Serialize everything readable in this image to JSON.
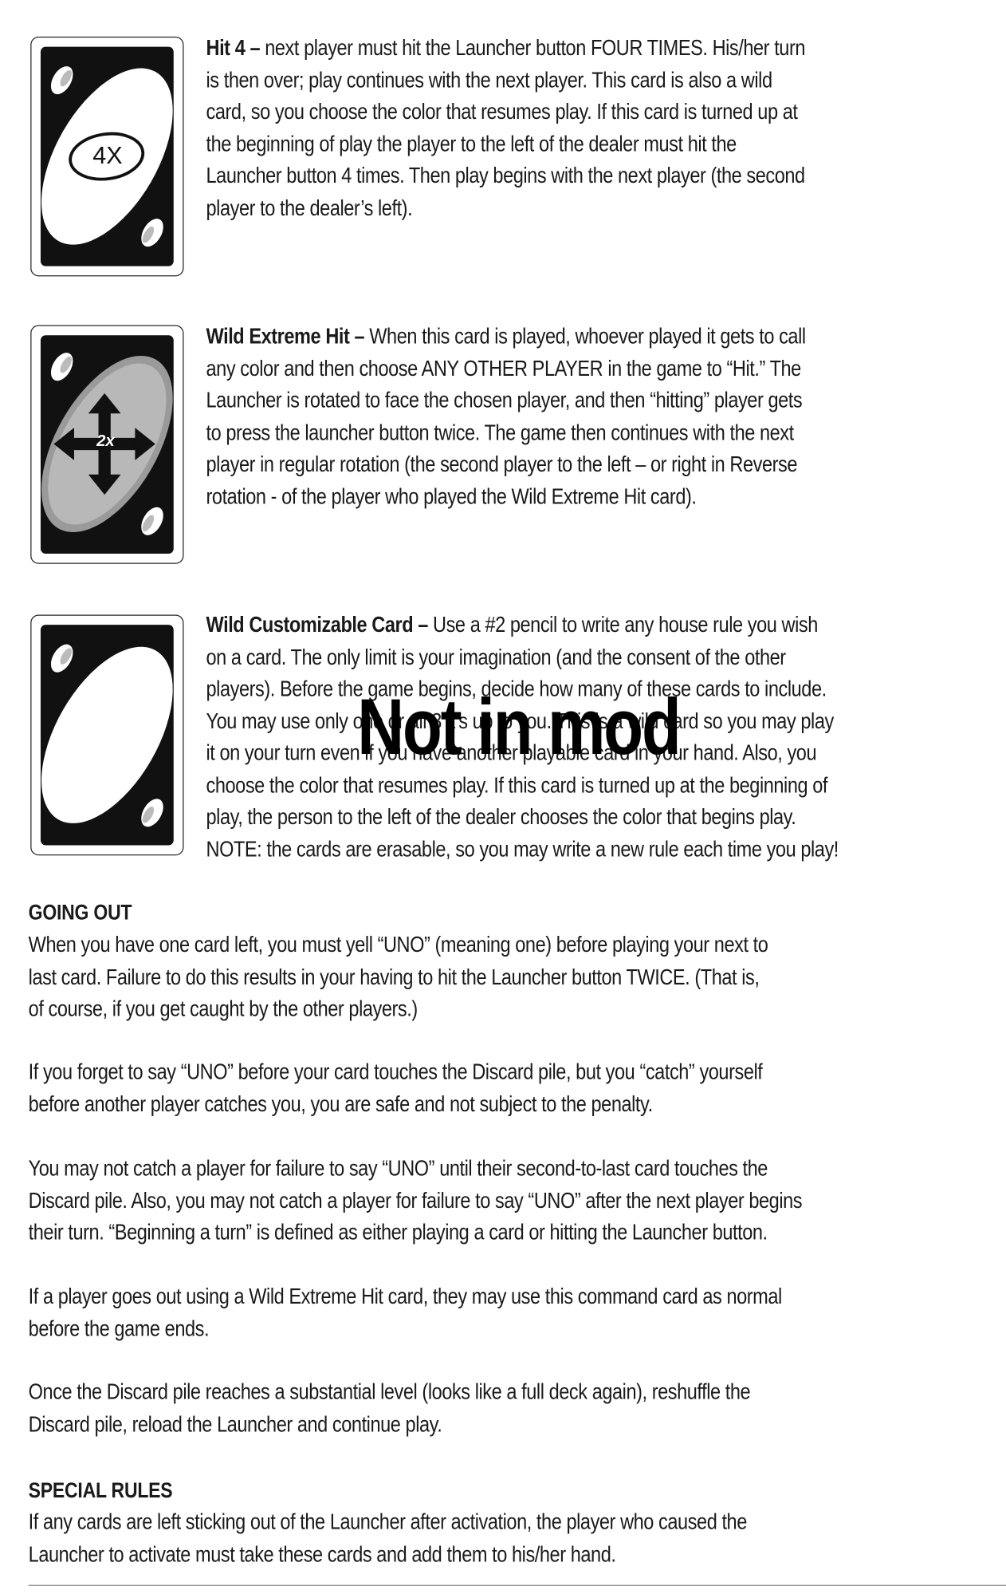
{
  "cards": {
    "hit4": {
      "icon_text": "4X",
      "title": "Hit 4 –",
      "lines": [
        " next player must hit the Launcher button FOUR TIMES. His/her turn",
        "is then over; play continues with the next player. This card is also a wild",
        "card, so you choose the color that resumes play. If this card is turned up at",
        "the beginning of play the player to the left of the dealer must hit the",
        "Launcher button 4 times. Then play begins with the next player (the second",
        "player to the dealer’s left)."
      ]
    },
    "wild_extreme_hit": {
      "icon_text": "2x",
      "title": "Wild Extreme Hit –",
      "lines": [
        " When this card is played, whoever played it gets to call",
        "any color and then choose ANY OTHER PLAYER in the game to “Hit.” The",
        "Launcher is rotated to face the chosen player, and then “hitting” player gets",
        "to press the launcher button twice. The game then continues with the next",
        "player in regular rotation (the second player to the left – or right in Reverse",
        "rotation - of the player who played the Wild Extreme Hit card)."
      ]
    },
    "wild_customizable": {
      "title": "Wild Customizable Card –",
      "lines": [
        " Use a #2 pencil to write any house rule you wish",
        "on a card. The only limit is your imagination (and the consent of the other",
        "players). Before the game begins, decide how many of these cards to include.",
        "You may use only one or all 3 it’s up to you. This is a wild card so you may play",
        "it on your turn even if you have another playable card in your hand. Also, you",
        "choose the color that resumes play. If this card is turned up at the beginning of",
        "play, the person to the left of the dealer chooses the color that begins play.",
        "NOTE: the cards are erasable, so you may write a new rule each time you play!"
      ]
    }
  },
  "watermark": "Not in mod",
  "going_out": {
    "heading": "GOING OUT",
    "paragraphs": [
      [
        "When you have one card left, you must yell “UNO” (meaning one) before playing your next to",
        "last card. Failure to do this results in your having to hit the Launcher button TWICE. (That is,",
        "of course, if you get caught by the other players.)"
      ],
      [
        "If you forget to say “UNO” before your card touches the Discard pile, but you “catch” yourself",
        "before another player catches you, you are safe and not subject to the penalty."
      ],
      [
        "You may not catch a player for failure to say “UNO” until their second-to-last card touches the",
        "Discard pile. Also, you may not catch a player for failure to say “UNO” after the next player begins",
        "their turn. “Beginning a turn” is defined as either playing a card or hitting the Launcher button."
      ],
      [
        "If a player goes out using a Wild Extreme Hit card, they may use this command card as normal",
        "before the game ends."
      ],
      [
        "Once the Discard pile reaches a substantial level (looks like a full deck again), reshuffle the",
        "Discard pile, reload the Launcher and continue play."
      ]
    ]
  },
  "special_rules": {
    "heading": "SPECIAL RULES",
    "lines": [
      "If any cards are left sticking out of the Launcher after activation, the player who caused the",
      "Launcher to activate must take these cards and add them to his/her hand."
    ]
  }
}
